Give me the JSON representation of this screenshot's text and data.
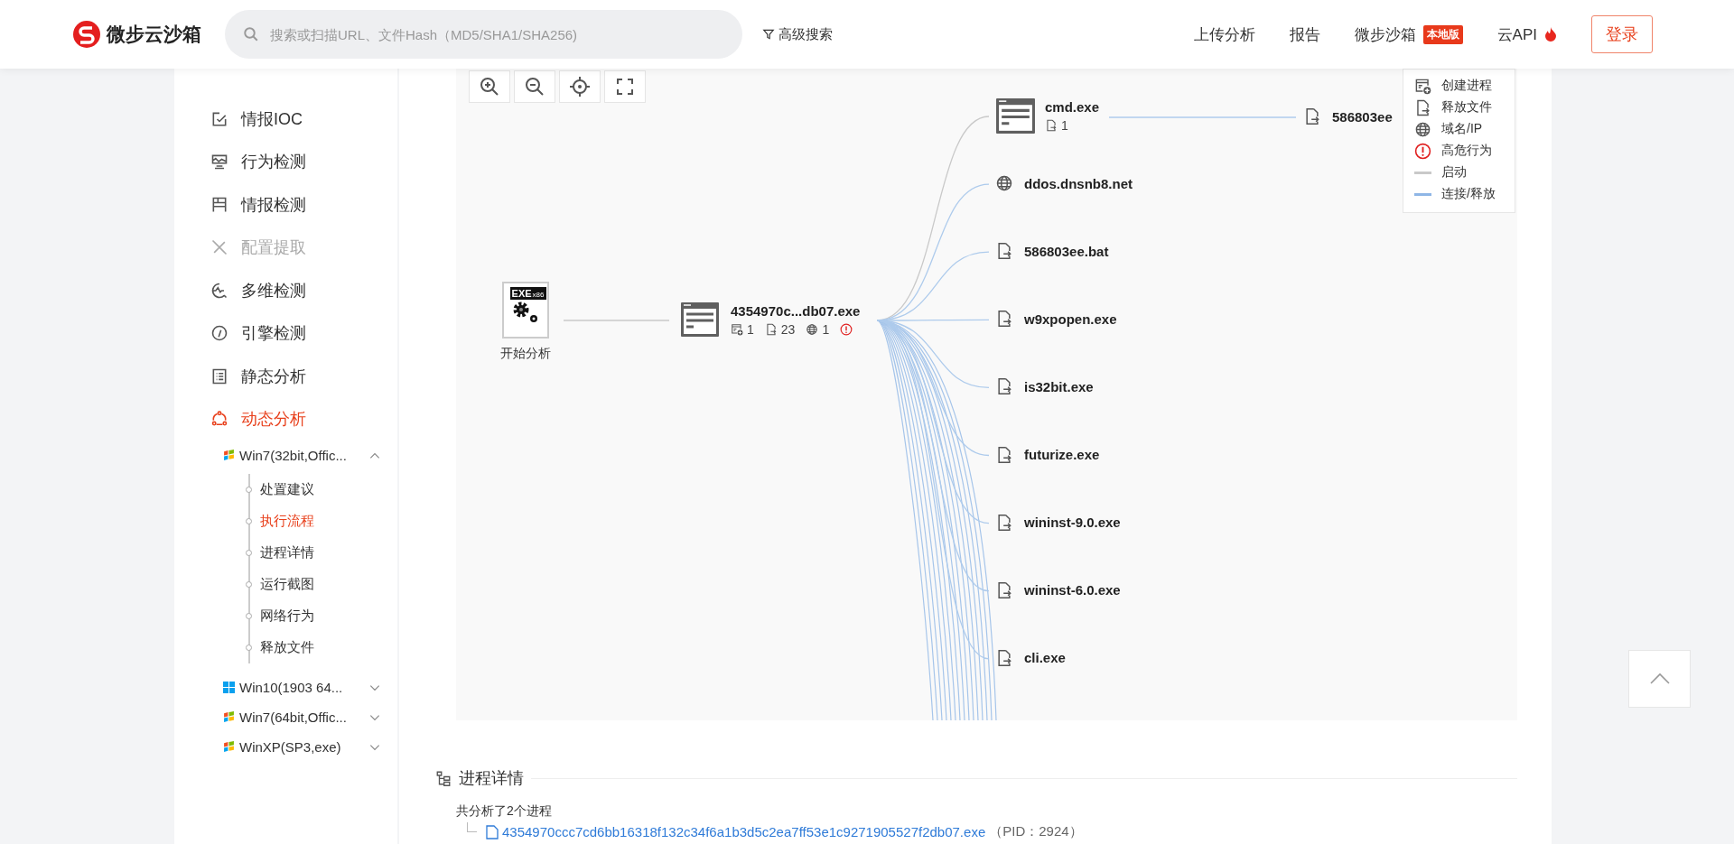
{
  "header": {
    "logo": "微步云沙箱",
    "search": {
      "placeholder": "搜索或扫描URL、文件Hash（MD5/SHA1/SHA256)"
    },
    "advanced_search": "高级搜索",
    "nav": [
      {
        "label": "上传分析",
        "hot": false
      },
      {
        "label": "报告",
        "hot": false
      },
      {
        "label": "微步沙箱",
        "badge": "本地版",
        "hot": false
      },
      {
        "label": "云API",
        "hot": true
      }
    ],
    "login": "登录"
  },
  "sidebar": {
    "items": [
      {
        "label": "情报IOC",
        "selected": false,
        "disabled": false
      },
      {
        "label": "行为检测",
        "selected": false,
        "disabled": false
      },
      {
        "label": "情报检测",
        "selected": false,
        "disabled": false
      },
      {
        "label": "配置提取",
        "selected": false,
        "disabled": true
      },
      {
        "label": "多维检测",
        "selected": false,
        "disabled": false
      },
      {
        "label": "引擎检测",
        "selected": false,
        "disabled": false
      },
      {
        "label": "静态分析",
        "selected": false,
        "disabled": false
      },
      {
        "label": "动态分析",
        "selected": true,
        "disabled": false
      }
    ],
    "environments": [
      {
        "kind": "flag",
        "label": "Win7(32bit,Offic...",
        "expanded": true,
        "children": [
          {
            "label": "处置建议",
            "selected": false
          },
          {
            "label": "执行流程",
            "selected": true
          },
          {
            "label": "进程详情",
            "selected": false
          },
          {
            "label": "运行截图",
            "selected": false
          },
          {
            "label": "网络行为",
            "selected": false
          },
          {
            "label": "释放文件",
            "selected": false
          }
        ]
      },
      {
        "kind": "tiles",
        "label": "Win10(1903 64...",
        "expanded": false
      },
      {
        "kind": "flag",
        "label": "Win7(64bit,Offic...",
        "expanded": false
      },
      {
        "kind": "flag",
        "label": "WinXP(SP3,exe)",
        "expanded": false
      }
    ]
  },
  "graph": {
    "start_node": {
      "file_type": "EXE",
      "arch": "x86",
      "label": "开始分析"
    },
    "main_node": {
      "name": "4354970c...db07.exe",
      "stats": [
        {
          "kind": "process",
          "value": "1"
        },
        {
          "kind": "file",
          "value": "23"
        },
        {
          "kind": "domain",
          "value": "1"
        }
      ],
      "danger": true
    },
    "children": [
      {
        "kind": "process",
        "name": "cmd.exe",
        "stats": [
          {
            "kind": "file",
            "value": "1"
          }
        ],
        "children": [
          {
            "kind": "file",
            "name": "586803ee"
          }
        ]
      },
      {
        "kind": "domain",
        "name": "ddos.dnsnb8.net"
      },
      {
        "kind": "file",
        "name": "586803ee.bat"
      },
      {
        "kind": "file",
        "name": "w9xpopen.exe"
      },
      {
        "kind": "file",
        "name": "is32bit.exe"
      },
      {
        "kind": "file",
        "name": "futurize.exe"
      },
      {
        "kind": "file",
        "name": "wininst-9.0.exe"
      },
      {
        "kind": "file",
        "name": "wininst-6.0.exe"
      },
      {
        "kind": "file",
        "name": "cli.exe"
      }
    ],
    "legend": [
      {
        "kind": "process",
        "label": "创建进程"
      },
      {
        "kind": "file",
        "label": "释放文件"
      },
      {
        "kind": "domain",
        "label": "域名/IP"
      },
      {
        "kind": "danger",
        "label": "高危行为"
      },
      {
        "kind": "start",
        "label": "启动"
      },
      {
        "kind": "link",
        "label": "连接/释放"
      }
    ]
  },
  "process_details": {
    "title": "进程详情",
    "summary": "共分析了2个进程",
    "processes": [
      {
        "name": "4354970ccc7cd6bb16318f132c34f6a1b3d5c2ea7ff53e1c9271905527f2db07.exe",
        "pid": "（PID：2924）"
      }
    ]
  }
}
